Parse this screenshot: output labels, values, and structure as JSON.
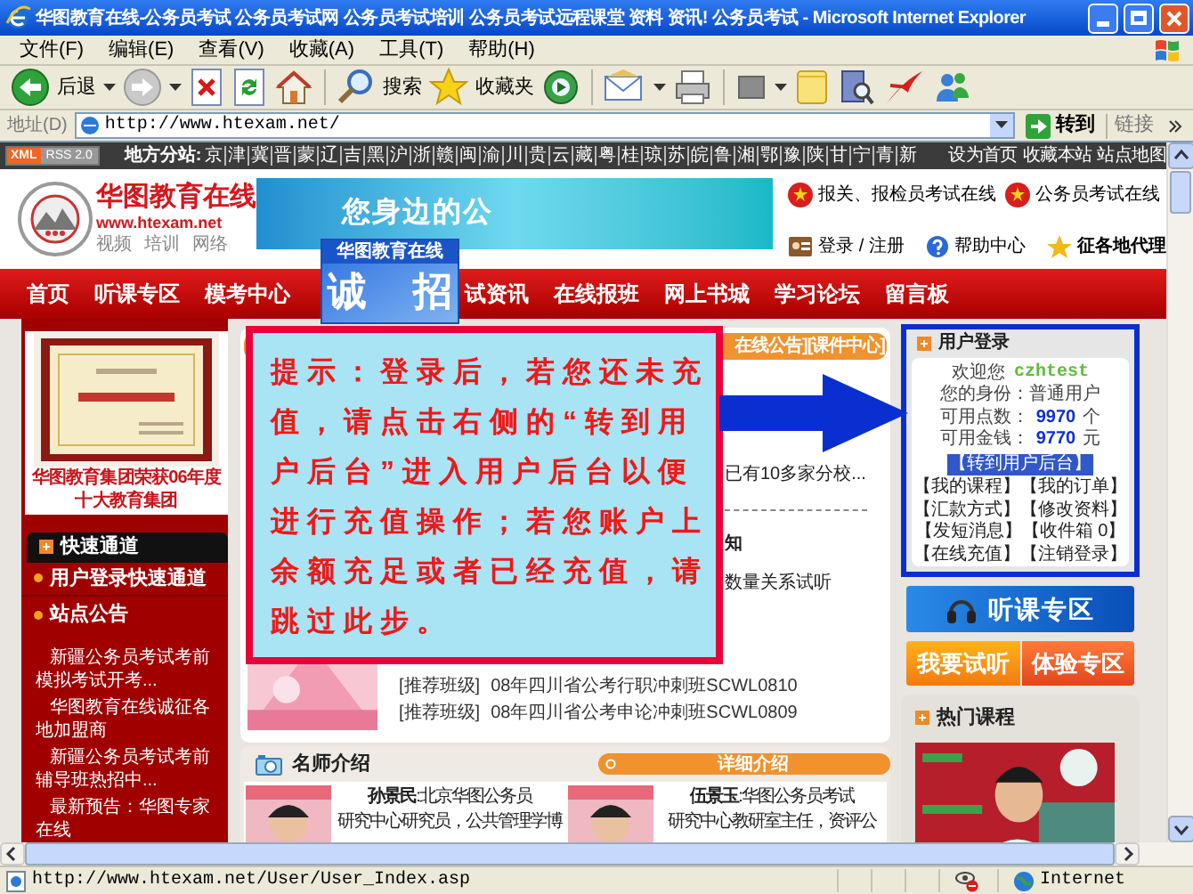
{
  "window": {
    "title": "华图教育在线-公务员考试 公务员考试网 公务员考试培训 公务员考试远程课堂 资料 资讯! 公务员考试 - Microsoft Internet Explorer"
  },
  "menu": [
    "文件(F)",
    "编辑(E)",
    "查看(V)",
    "收藏(A)",
    "工具(T)",
    "帮助(H)"
  ],
  "toolbar": [
    {
      "kind": "back",
      "label": "后退"
    },
    {
      "kind": "forward"
    },
    {
      "kind": "stop"
    },
    {
      "kind": "refresh"
    },
    {
      "kind": "home"
    },
    {
      "kind": "search",
      "label": "搜索"
    },
    {
      "kind": "favorites",
      "label": "收藏夹"
    },
    {
      "kind": "media"
    },
    {
      "kind": "mail"
    },
    {
      "kind": "print"
    },
    {
      "kind": "blank"
    },
    {
      "kind": "note"
    },
    {
      "kind": "research"
    },
    {
      "kind": "messenger"
    },
    {
      "kind": "people"
    }
  ],
  "address_bar": {
    "label": "地址(D)",
    "value": "http://www.htexam.net/",
    "go": "转到",
    "links": "链接"
  },
  "site_bar": {
    "badge": [
      "XML",
      "RSS 2.0"
    ],
    "label": "地方分站:",
    "branches": [
      "京",
      "津",
      "冀",
      "晋",
      "蒙",
      "辽",
      "吉",
      "黑",
      "沪",
      "浙",
      "赣",
      "闽",
      "渝",
      "川",
      "贵",
      "云",
      "藏",
      "粤",
      "桂",
      "琼",
      "苏",
      "皖",
      "鲁",
      "湘",
      "鄂",
      "豫",
      "陕",
      "甘",
      "宁",
      "青",
      "新"
    ],
    "links": [
      "设为首页",
      "收藏本站",
      "站点地图"
    ]
  },
  "header": {
    "name": "华图教育在线",
    "url": "www.htexam.net",
    "tags": [
      "视频",
      "培训",
      "网络"
    ],
    "banner": "您身边的公",
    "links": [
      {
        "kind": "emblem",
        "label": "报关、报检员考试在线"
      },
      {
        "kind": "emblem",
        "label": "公务员考试在线"
      },
      {
        "kind": "login",
        "label": "登录 / 注册"
      },
      {
        "kind": "help",
        "label": "帮助中心"
      },
      {
        "kind": "star",
        "label": "征各地代理"
      }
    ]
  },
  "nav": [
    "首页",
    "听课专区",
    "模考中心",
    "试资讯",
    "在线报班",
    "网上书城",
    "学习论坛",
    "留言板"
  ],
  "recruit_popup": {
    "title": "华图教育在线",
    "chars": [
      "诚",
      "招"
    ]
  },
  "left": {
    "award_caption": [
      "华图教育集团荣获06年度",
      "十大教育集团"
    ],
    "quick_title": "快速通道",
    "quick_items": [
      "用户登录快速通道",
      "站点公告"
    ],
    "news": [
      "新疆公务员考试考前模拟考试开考...",
      "华图教育在线诚征各地加盟商",
      "新疆公务员考试考前辅导班热招中...",
      "最新预告：华图专家在线"
    ]
  },
  "hint": "提示：登录后，若您还未充值，请点击右侧的“转到用户后台”进入用户后台以便进行充值操作；若您账户上余额充足或者已经充值，请跳过此步。",
  "center": {
    "tab": "在线公告][课件中心]",
    "lines": [
      {
        "kind": "plain",
        "text": "已有10多家分校..."
      },
      {
        "kind": "bold",
        "text": "知"
      },
      {
        "kind": "plain",
        "text": "数量关系试听"
      }
    ],
    "recommend": [
      {
        "tag": "[推荐班级]",
        "text": "08年四川省公考行职冲刺班SCWL0810"
      },
      {
        "tag": "[推荐班级]",
        "text": "08年四川省公考申论冲刺班SCWL0809"
      }
    ]
  },
  "teachers": {
    "title": "名师介绍",
    "more": "详细介绍",
    "items": [
      {
        "lines": [
          "**孙景民**:北京华图公务员",
          "研究中心研究员，公共管理学博"
        ]
      },
      {
        "lines": [
          "**伍景玉**:华图公务员考试",
          "研究中心教研室主任，资评公"
        ]
      }
    ]
  },
  "user_login": {
    "title": "用户登录",
    "welcome": "欢迎您",
    "username": "czhtest",
    "identity": "您的身份：普通用户",
    "stats": [
      {
        "label": "可用点数：",
        "value": "9970",
        "unit": "个"
      },
      {
        "label": "可用金钱：",
        "value": "9770",
        "unit": "元"
      }
    ],
    "backend": "【转到用户后台】",
    "links": [
      "【我的课程】",
      "【我的订单】",
      "【汇款方式】",
      "【修改资料】",
      "【发短消息】",
      "【收件箱 0】",
      "【在线充值】",
      "【注销登录】"
    ]
  },
  "promo": {
    "listen": "听课专区",
    "try": "我要试听",
    "experience": "体验专区"
  },
  "hot": {
    "title": "热门课程"
  },
  "status_bar": {
    "url": "http://www.htexam.net/User/User_Index.asp",
    "zone": "Internet"
  }
}
